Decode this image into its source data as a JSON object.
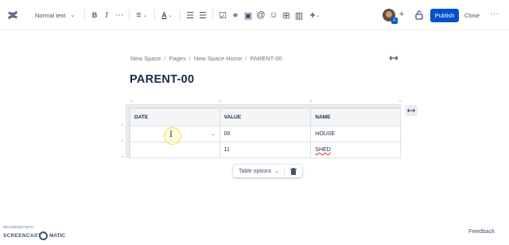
{
  "toolbar": {
    "text_style": "Normal text",
    "bold": "B",
    "italic": "I",
    "more_formatting": "···",
    "align": "≡",
    "text_color": "A",
    "bullet_list": "☰",
    "numbered_list": "☰",
    "checkbox": "☑",
    "link": "⚭",
    "image": "▣",
    "mention": "@",
    "emoji": "☺",
    "table": "⊞",
    "layout": "▥",
    "insert": "+",
    "invite": "+",
    "avatar_badge": "G",
    "publish": "Publish",
    "close": "Close",
    "more": "···"
  },
  "breadcrumb": {
    "items": [
      "New Space",
      "Pages",
      "New Space Home",
      "PARENT-00"
    ],
    "separator": "/"
  },
  "page": {
    "title": "PARENT-00"
  },
  "table": {
    "headers": [
      "DATE",
      "VALUE",
      "NAME"
    ],
    "rows": [
      [
        "",
        "00",
        "HOUSE"
      ],
      [
        "",
        "11",
        "SHED"
      ]
    ]
  },
  "table_options": {
    "label": "Table options"
  },
  "footer": {
    "watermark_small": "RECORDED WITH",
    "watermark_brand_left": "SCREENCAST",
    "watermark_brand_right": "MATIC",
    "feedback": "Feedback"
  },
  "colors": {
    "accent": "#0052cc",
    "text": "#172b4d",
    "muted": "#6b778c",
    "border": "#dfe1e6"
  }
}
